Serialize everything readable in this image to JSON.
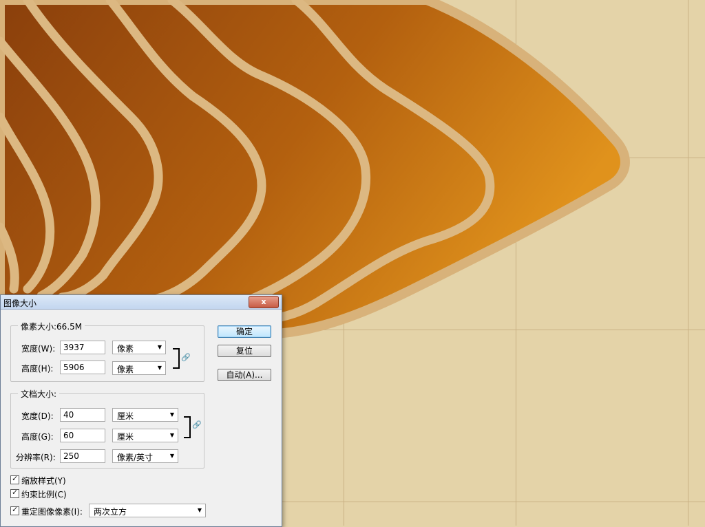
{
  "dialog": {
    "title": "图像大小",
    "close_glyph": "x",
    "pixel_group": {
      "legend": "像素大小:66.5M",
      "width_label": "宽度(W):",
      "width_value": "3937",
      "width_unit": "像素",
      "height_label": "高度(H):",
      "height_value": "5906",
      "height_unit": "像素"
    },
    "doc_group": {
      "legend": "文档大小:",
      "width_label": "宽度(D):",
      "width_value": "40",
      "width_unit": "厘米",
      "height_label": "高度(G):",
      "height_value": "60",
      "height_unit": "厘米",
      "res_label": "分辨率(R):",
      "res_value": "250",
      "res_unit": "像素/英寸"
    },
    "buttons": {
      "ok": "确定",
      "reset": "复位",
      "auto": "自动(A)..."
    },
    "checkboxes": {
      "scale_styles": "缩放样式(Y)",
      "constrain": "约束比例(C)",
      "resample": "重定图像像素(I):"
    },
    "resample_method": "两次立方"
  },
  "icons": {
    "link": "link-chain-icon",
    "dropdown": "chevron-down-icon",
    "check": "checkmark-icon"
  },
  "colors": {
    "background_paper": "#e4d3a8",
    "brown_dark": "#8a3f0c",
    "brown_light": "#d88a1a",
    "band_stroke": "#d8b27a"
  }
}
